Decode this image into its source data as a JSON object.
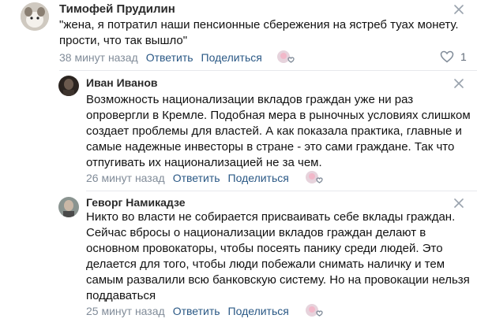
{
  "comments": [
    {
      "author": "Тимофей Прудилин",
      "text_lines": [
        "\"жена, я потратил наши пенсионные сбережения на ястреб туах монету.",
        "прости, что так вышло\""
      ],
      "time": "38 минут назад",
      "reply_label": "Ответить",
      "share_label": "Поделиться",
      "like_count": "1"
    },
    {
      "author": "Иван Иванов",
      "text_lines": [
        "Возможность национализации вкладов граждан уже ни раз",
        "опровергли в Кремле. Подобная мера в рыночных условиях слишком",
        "создает проблемы для властей. А как показала практика, главные и",
        "самые надежные инвесторы в стране - это сами граждане. Так что",
        "отпугивать их национализацией не за чем."
      ],
      "time": "26 минут назад",
      "reply_label": "Ответить",
      "share_label": "Поделиться"
    },
    {
      "author": "Геворг Намикадзе",
      "text_lines": [
        "Никто во власти не собирается присваивать себе вклады граждан.",
        "Сейчас вбросы о национализации вкладов граждан делают в",
        "основном провокаторы, чтобы посеять панику среди людей. Это",
        "делается для того, чтобы люди побежали снимать наличку и тем",
        "самым развалили всю банковскую систему. Но на провокации нельзя",
        "поддаваться"
      ],
      "time": "25 минут назад",
      "reply_label": "Ответить",
      "share_label": "Поделиться"
    }
  ],
  "icons": {
    "close": "close-icon",
    "reactions": "reactions-icon",
    "like": "heart-icon"
  },
  "colors": {
    "link": "#2a5885",
    "meta": "#818c99",
    "divider": "#e7e8ec"
  }
}
